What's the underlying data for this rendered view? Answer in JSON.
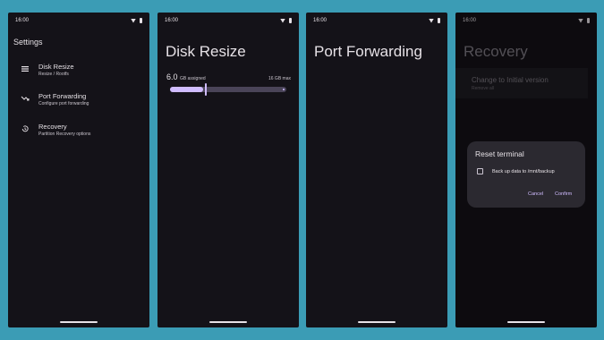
{
  "status": {
    "time": "16:00"
  },
  "settings": {
    "title": "Settings",
    "items": [
      {
        "label": "Disk Resize",
        "sub": "Resize / Rootfs",
        "icon": "storage-icon"
      },
      {
        "label": "Port Forwarding",
        "sub": "Configure port forwarding",
        "icon": "trending-icon"
      },
      {
        "label": "Recovery",
        "sub": "Partition Recovery options",
        "icon": "history-icon"
      }
    ]
  },
  "disk": {
    "title": "Disk Resize",
    "value": "6.0",
    "unit": "GB assigned",
    "max": "16 GB max",
    "fraction": 0.3
  },
  "port": {
    "title": "Port Forwarding"
  },
  "recovery": {
    "title": "Recovery",
    "item_label": "Change to Initial version",
    "item_sub": "Remove all",
    "dialog": {
      "title": "Reset terminal",
      "checkbox_label": "Back up data to /mnt/backup",
      "cancel": "Cancel",
      "confirm": "Confirm"
    }
  },
  "colors": {
    "background": "#3b9cb5",
    "screen": "#141218",
    "accent": "#d0bcff"
  }
}
